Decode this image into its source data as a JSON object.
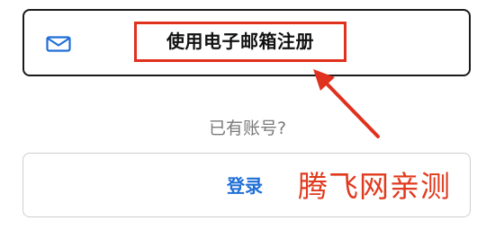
{
  "email_signup": {
    "label": "使用电子邮箱注册",
    "icon": "mail-icon"
  },
  "account_prompt": {
    "text": "已有账号?"
  },
  "login": {
    "label": "登录"
  },
  "watermark": {
    "text": "腾飞网亲测"
  },
  "colors": {
    "accent_blue": "#1f6fd6",
    "annotation_red": "#e0301e",
    "border_dark": "#1a1a1a",
    "muted_text": "#7a7a7a"
  }
}
